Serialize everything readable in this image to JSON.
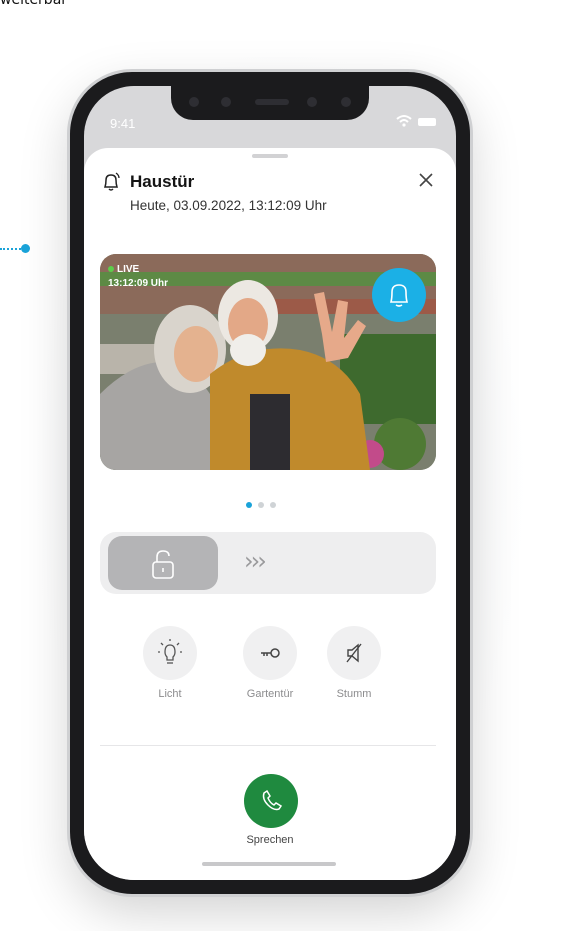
{
  "page": {
    "caption": "weiterbar"
  },
  "status_bar": {
    "time": "9:41"
  },
  "notification": {
    "title": "Haustür",
    "subtitle": "Heute, 03.09.2022, 13:12:09 Uhr"
  },
  "video": {
    "live_label": "LIVE",
    "timestamp": "13:12:09 Uhr"
  },
  "pager": {
    "count": 3,
    "active_index": 0
  },
  "unlock": {
    "chevrons": "›››"
  },
  "actions": [
    {
      "label": "Licht",
      "icon": "lightbulb-icon"
    },
    {
      "label": "Gartentür",
      "icon": "key-icon"
    },
    {
      "label": "Stumm",
      "icon": "mute-icon"
    }
  ],
  "call": {
    "label": "Sprechen",
    "icon": "phone-icon"
  },
  "colors": {
    "accent": "#1aa3d9",
    "call_green": "#1f8a3f",
    "bell_blue": "#1bb0e6"
  }
}
